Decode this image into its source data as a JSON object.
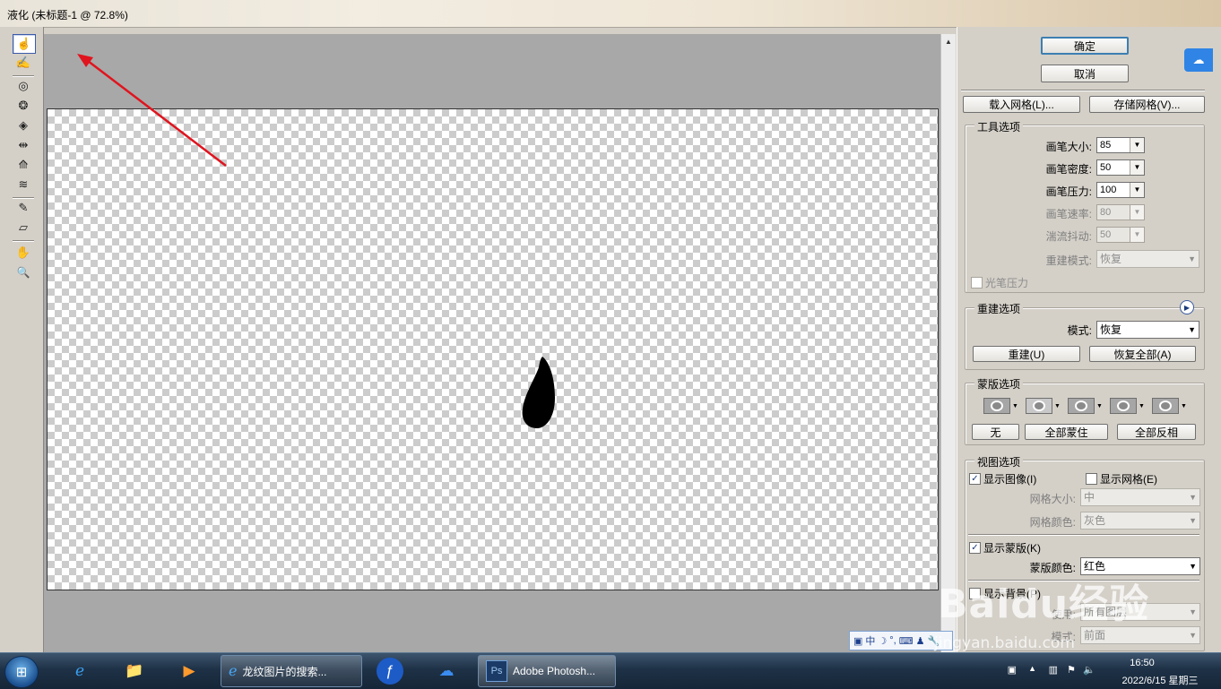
{
  "window": {
    "title": "液化 (未标题-1 @ 72.8%)"
  },
  "toolbar": {
    "tools": [
      {
        "name": "forward-warp-tool",
        "glyph": "☝"
      },
      {
        "name": "reconstruct-tool",
        "glyph": "✍"
      },
      {
        "name": "twirl-tool",
        "glyph": "◎"
      },
      {
        "name": "pucker-tool",
        "glyph": "❂"
      },
      {
        "name": "bloat-tool",
        "glyph": "◈"
      },
      {
        "name": "push-left-tool",
        "glyph": "⇹"
      },
      {
        "name": "mirror-tool",
        "glyph": "⟰"
      },
      {
        "name": "turbulence-tool",
        "glyph": "≋"
      },
      {
        "name": "freeze-mask-tool",
        "glyph": "✎"
      },
      {
        "name": "thaw-mask-tool",
        "glyph": "▱"
      },
      {
        "name": "hand-tool",
        "glyph": "✋"
      },
      {
        "name": "zoom-tool",
        "glyph": "🔍"
      }
    ]
  },
  "buttons": {
    "ok": "确定",
    "cancel": "取消",
    "load_mesh": "载入网格(L)...",
    "save_mesh": "存储网格(V)...",
    "reconstruct": "重建(U)",
    "restore_all": "恢复全部(A)",
    "none": "无",
    "mask_all": "全部蒙住",
    "invert_all": "全部反相"
  },
  "tool_options": {
    "legend": "工具选项",
    "brush_size": {
      "label": "画笔大小:",
      "value": "85"
    },
    "brush_density": {
      "label": "画笔密度:",
      "value": "50"
    },
    "brush_pressure": {
      "label": "画笔压力:",
      "value": "100"
    },
    "brush_rate": {
      "label": "画笔速率:",
      "value": "80"
    },
    "turbulent_jitter": {
      "label": "湍流抖动:",
      "value": "50"
    },
    "reconstruct_mode": {
      "label": "重建模式:",
      "value": "恢复"
    },
    "stylus_pressure": "光笔压力"
  },
  "reconstruct_options": {
    "legend": "重建选项",
    "mode_label": "模式:",
    "mode_value": "恢复"
  },
  "mask_options": {
    "legend": "蒙版选项"
  },
  "view_options": {
    "legend": "视图选项",
    "show_image": "显示图像(I)",
    "show_mesh": "显示网格(E)",
    "mesh_size_label": "网格大小:",
    "mesh_size_value": "中",
    "mesh_color_label": "网格颜色:",
    "mesh_color_value": "灰色",
    "show_mask": "显示蒙版(K)",
    "mask_color_label": "蒙版颜色:",
    "mask_color_value": "红色",
    "show_backdrop": "显示背景(P)",
    "use_label": "使用:",
    "use_value": "所有图层",
    "mode_label": "模式:",
    "mode_value": "前面"
  },
  "ime": {
    "lang": "中"
  },
  "taskbar": {
    "tasks": [
      {
        "label": "龙纹图片的搜索..."
      },
      {
        "label": "Adobe Photosh..."
      }
    ],
    "clock_time": "16:50",
    "clock_date": "2022/6/15 星期三"
  },
  "watermark": {
    "main": "Baidu经验",
    "sub": "jingyan.baidu.com"
  },
  "colors": {
    "annotation_arrow": "#e0141e",
    "default_button_border": "#3c7fb1"
  }
}
